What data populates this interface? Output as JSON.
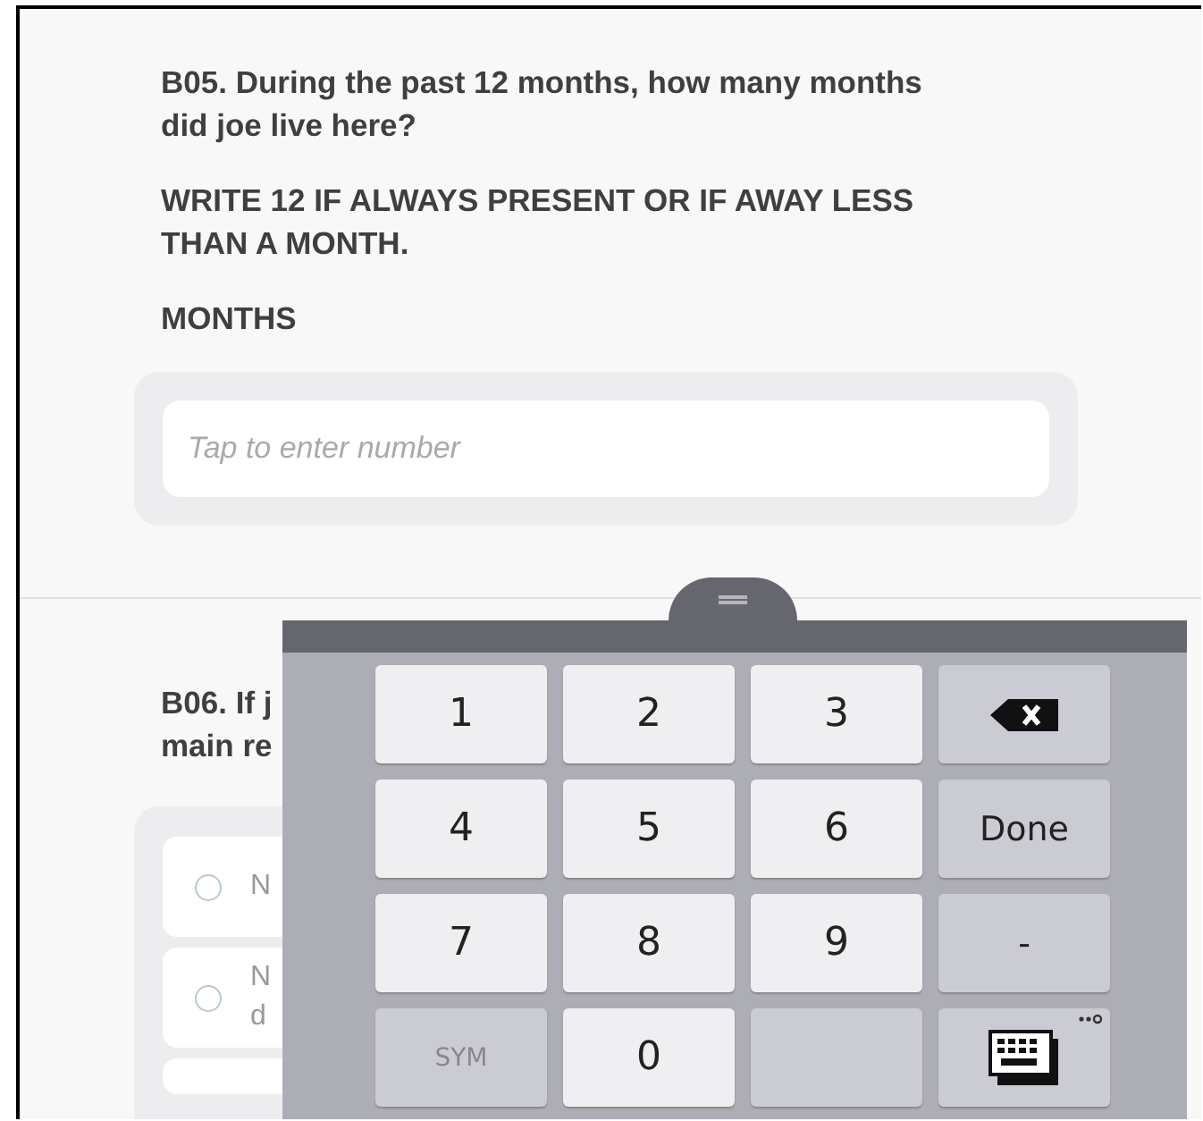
{
  "question_1": {
    "lines": [
      "B05. During the past 12 months, how many months did joe live here?",
      "WRITE 12 IF ALWAYS PRESENT OR IF AWAY LESS THAN A MONTH.",
      "MONTHS"
    ],
    "input": {
      "placeholder": "Tap to enter number"
    }
  },
  "question_2": {
    "lines": [
      "B06. If j",
      "main re"
    ],
    "options": [
      {
        "label": "N",
        "selected": false
      },
      {
        "label": "N\nd",
        "selected": false
      }
    ]
  },
  "keyboard": {
    "keys": [
      {
        "kind": "digit",
        "label": "1"
      },
      {
        "kind": "digit",
        "label": "2"
      },
      {
        "kind": "digit",
        "label": "3"
      },
      {
        "kind": "backspace"
      },
      {
        "kind": "digit",
        "label": "4"
      },
      {
        "kind": "digit",
        "label": "5"
      },
      {
        "kind": "digit",
        "label": "6"
      },
      {
        "kind": "action",
        "label": "Done"
      },
      {
        "kind": "digit",
        "label": "7"
      },
      {
        "kind": "digit",
        "label": "8"
      },
      {
        "kind": "digit",
        "label": "9"
      },
      {
        "kind": "action",
        "label": "-"
      },
      {
        "kind": "function",
        "label": "SYM"
      },
      {
        "kind": "digit",
        "label": "0"
      },
      {
        "kind": "blank"
      },
      {
        "kind": "switch"
      }
    ]
  }
}
